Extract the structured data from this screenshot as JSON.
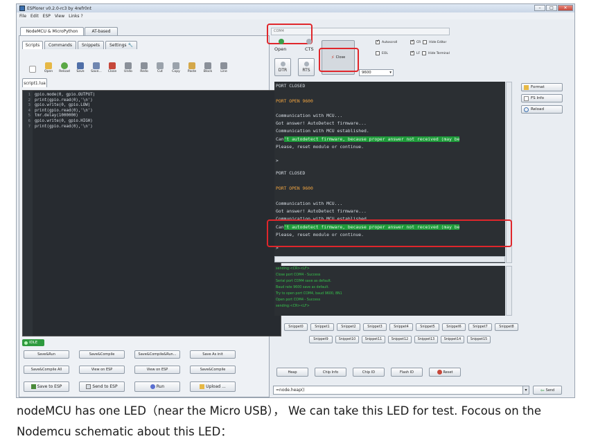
{
  "window": {
    "title": "ESPlorer v0.2.0-rc3 by 4refr0nt"
  },
  "menu": [
    "File",
    "Edit",
    "ESP",
    "View",
    "Links ?"
  ],
  "top_tabs": [
    "NodeMCU & MicroPython",
    "AT-based"
  ],
  "sub_tabs": [
    "Scripts",
    "Commands",
    "Snippets",
    "Settings"
  ],
  "toolbar": [
    "Open",
    "Reload",
    "Save",
    "Save...",
    "Close",
    "Undo",
    "Redo",
    "Cut",
    "Copy",
    "Paste",
    "Block",
    "Line"
  ],
  "file_tab": "script1.lua",
  "code": {
    "line_numbers": [
      "1",
      "2",
      "3",
      "4",
      "5",
      "6",
      "7"
    ],
    "lines": [
      "gpio.mode(0, gpio.OUTPUT)",
      "print(gpio.read(0),'\\n')",
      "gpio.write(0, gpio.LOW)",
      "print(gpio.read(0),'\\n')",
      "tmr.delay(1000000)",
      "gpio.write(0, gpio.HIGH)",
      "print(gpio.read(0),'\\n')"
    ]
  },
  "status": {
    "idle": "IDLE"
  },
  "left_buttons": {
    "row1": [
      "Save&Run",
      "Save&Compile",
      "Save&Compile&Run...",
      "Save As init"
    ],
    "row2": [
      "Save&Compile All",
      "View on ESP",
      "View on ESP",
      "Save&Compile"
    ],
    "row3": [
      "Save to ESP",
      "Send to ESP",
      "Run",
      "Upload ..."
    ]
  },
  "port": {
    "name": "COM4",
    "open_label": "Open",
    "cts_label": "CTS",
    "dtr_label": "DTR",
    "rts_label": "RTS",
    "close_label": "Close",
    "baud": "9600"
  },
  "options": {
    "autoscroll": "Autoscroll",
    "cr": "CR",
    "hide_editor": "Hide Editor",
    "eol": "EOL",
    "lf": "LF",
    "hide_terminal": "Hide Terminal"
  },
  "terminal": {
    "lines": [
      "PORT CLOSED",
      "PORT OPEN 9600",
      "Communication with MCU...",
      "Got answer! AutoDetect firmware...",
      "Communication with MCU established.",
      "Can't autodetect firmware, because proper answer not received (may be",
      "Please, reset module or continue.",
      ">",
      "PORT CLOSED",
      "PORT OPEN 9600",
      "Communication with MCU...",
      "Got answer! AutoDetect firmware...",
      "Communication with MCU established.",
      "Can't autodetect firmware, because proper answer not received (may be",
      "Please, reset module or continue.",
      ">"
    ]
  },
  "log": {
    "lines": [
      "sending:<CR><LF>",
      "Close port COM4 - Success",
      "Serial port COM4 save as default.",
      "Baud rate 9600 save as default.",
      "Try to open port COM4, baud 9600, 8N1",
      "Open port COM4 - Success",
      "sending:<CR><LF>"
    ]
  },
  "side_buttons": [
    "Format",
    "FS Info",
    "Reload"
  ],
  "snippets": {
    "row1": [
      "Snippet0",
      "Snippet1",
      "Snippet2",
      "Snippet3",
      "Snippet4",
      "Snippet5",
      "Snippet6",
      "Snippet7",
      "Snippet8"
    ],
    "row2": [
      "Snippet9",
      "Snippet10",
      "Snippet11",
      "Snippet12",
      "Snippet13",
      "Snippet14",
      "Snippet15"
    ]
  },
  "bottom_buttons": [
    "Heap",
    "Chip Info",
    "Chip ID",
    "Flash ID",
    "Reset"
  ],
  "command": {
    "value": "=node.heap()",
    "send_label": "Send"
  },
  "caption": {
    "line1": "nodeMCU has one LED（near the Micro USB）， We can take this LED for test. Focous on the",
    "line2": "Nodemcu schematic about this LED："
  },
  "colors": {
    "terminal_bg": "#2b2f33",
    "highlight": "#1e9b3a",
    "annotation": "#e0262b",
    "log_text": "#37c34d"
  }
}
